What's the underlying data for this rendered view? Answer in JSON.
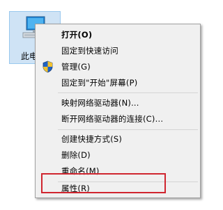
{
  "desktop": {
    "icon_label": "此电",
    "icon_name": "this-pc-icon"
  },
  "menu": {
    "items": [
      {
        "label": "打开(O)",
        "bold": true
      },
      {
        "label": "固定到快速访问"
      },
      {
        "label": "管理(G)",
        "icon": "uac-shield-icon"
      },
      {
        "label": "固定到\"开始\"屏幕(P)"
      },
      {
        "label": "映射网络驱动器(N)..."
      },
      {
        "label": "断开网络驱动器的连接(C)..."
      },
      {
        "label": "创建快捷方式(S)"
      },
      {
        "label": "删除(D)"
      },
      {
        "label": "重命名(M)"
      },
      {
        "label": "属性(R)"
      }
    ]
  },
  "colors": {
    "menu_background": "#f0f0f0",
    "highlight_border": "#d0252f",
    "icon_selection": "#cfe3f5"
  }
}
